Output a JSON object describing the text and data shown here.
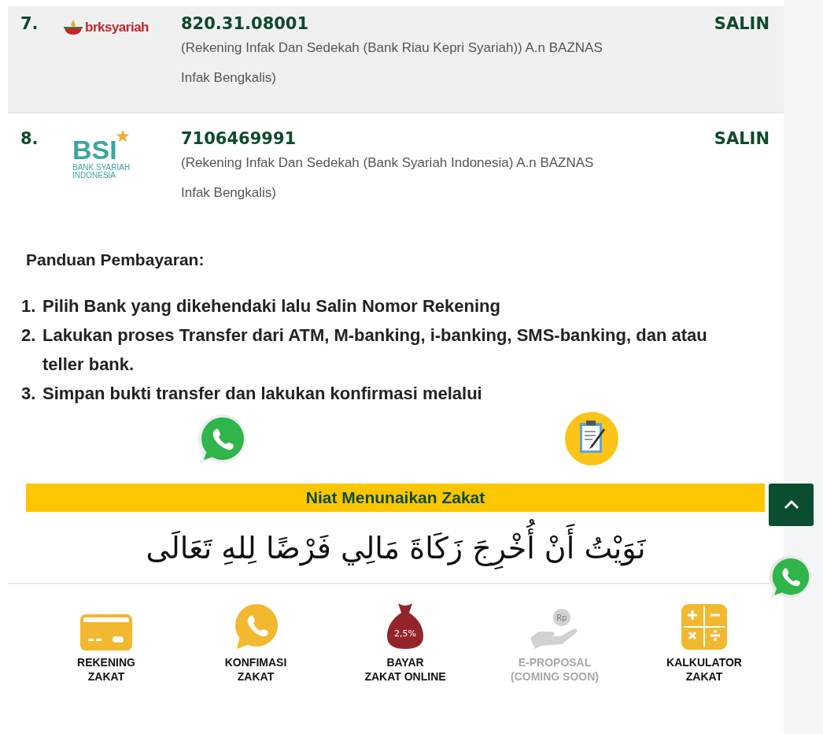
{
  "accounts": [
    {
      "number_label": "7.",
      "logo": {
        "kind": "brk",
        "text": "brksyariah"
      },
      "account_number": "820.31.08001",
      "description": "(Rekening Infak Dan Sedekah (Bank Riau Kepri Syariah)) A.n BAZNAS Infak Bengkalis)",
      "copy_label": "SALIN",
      "highlighted": true
    },
    {
      "number_label": "8.",
      "logo": {
        "kind": "bsi",
        "text": "BSI",
        "subtitle": "BANK SYARIAH INDONESIA"
      },
      "account_number": "7106469991",
      "description": "(Rekening Infak Dan Sedekah (Bank Syariah Indonesia) A.n BAZNAS Infak Bengkalis)",
      "copy_label": "SALIN",
      "highlighted": false
    }
  ],
  "guide": {
    "title": "Panduan Pembayaran:",
    "steps": [
      {
        "marker": "1.",
        "text": "Pilih **Bank** yang dikehendaki lalu Salin Nomor Rekening"
      },
      {
        "marker": "2.",
        "text": "Lakukan proses Transfer dari ATM, M-banking, i-banking, SMS-banking, dan atau teller bank."
      },
      {
        "marker": "3.",
        "text": "Simpan bukti transfer dan lakukan konfirmasi melalui"
      }
    ],
    "confirm_links": [
      {
        "kind": "whatsapp"
      },
      {
        "kind": "form"
      }
    ]
  },
  "niat": {
    "title": "Niat Menunaikan Zakat",
    "arabic": "نَوَيْتُ أَنْ أُخْرِجَ زَكَاةَ مَالِي فَرْضًا لِلهِ تَعَالَى"
  },
  "bottom_nav": [
    {
      "kind": "card",
      "lines": [
        "REKENING",
        "ZAKAT"
      ],
      "disabled": false
    },
    {
      "kind": "phone",
      "lines": [
        "KONFIMASI",
        "ZAKAT"
      ],
      "disabled": false
    },
    {
      "kind": "bag",
      "lines": [
        "BAYAR",
        "ZAKAT ONLINE"
      ],
      "badge": "2,5%",
      "disabled": false
    },
    {
      "kind": "hand",
      "lines": [
        "E-PROPOSAL",
        "(COMING SOON)"
      ],
      "badge": "Rp",
      "disabled": true
    },
    {
      "kind": "calculator",
      "lines": [
        "KALKULATOR",
        "ZAKAT"
      ],
      "disabled": false
    }
  ]
}
